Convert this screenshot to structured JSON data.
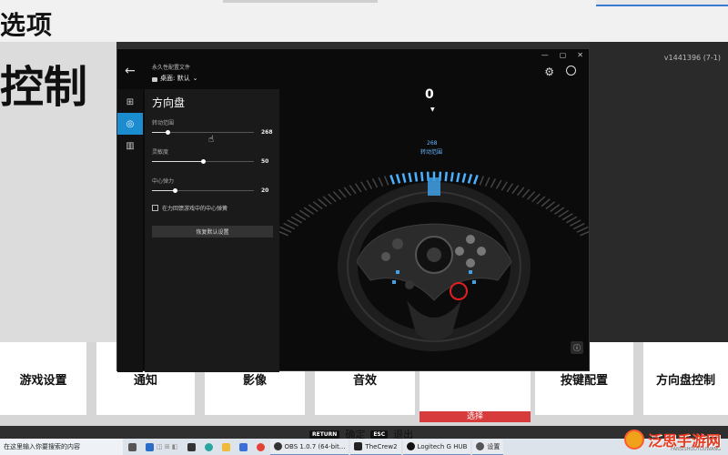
{
  "game": {
    "top_title": "选项",
    "big_title": "控制",
    "version": "v1441396 (7-1)",
    "menu": [
      "游戏设置",
      "通知",
      "影像",
      "音效",
      "",
      "按键配置",
      "方向盘控制"
    ],
    "select_label": "选择",
    "hints": {
      "confirm_key": "RETURN",
      "confirm": "确定",
      "back_key": "ESC",
      "back": "退出"
    }
  },
  "ghub": {
    "profile_small": "永久性配置文件",
    "profile_name": "桌面: 默认",
    "panel_title": "方向盘",
    "sliders": [
      {
        "label": "转动范围",
        "value": "268",
        "fraction": 0.15
      },
      {
        "label": "灵敏度",
        "value": "50",
        "fraction": 0.5
      },
      {
        "label": "中心弹力",
        "value": "20",
        "fraction": 0.22
      }
    ],
    "checkbox_label": "在力回馈游戏中的中心弹簧",
    "reset_label": "恢复默认设置",
    "rotation": {
      "display": "0",
      "value": "268",
      "label": "转动范围"
    }
  },
  "taskbar": {
    "search_text": "在这里输入你要搜索的内容",
    "apps": [
      {
        "label": "OBS 1.0.7 (64-bit...",
        "icon": "obs-icon"
      },
      {
        "label": "TheCrew2",
        "icon": "game-icon"
      },
      {
        "label": "Logitech G HUB",
        "icon": "logitech-icon"
      },
      {
        "label": "设置",
        "icon": "settings-icon"
      }
    ]
  },
  "watermark": {
    "text": "泛思手游网",
    "sub": "FANSISHOUYOUWANG"
  }
}
